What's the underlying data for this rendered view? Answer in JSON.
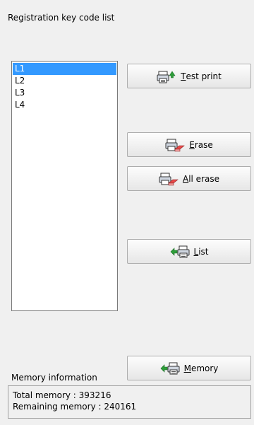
{
  "title": "Registration key code list",
  "list": {
    "items": [
      "L1",
      "L2",
      "L3",
      "L4"
    ],
    "selected_index": 0
  },
  "buttons": {
    "test_print": {
      "mnemonic": "T",
      "rest": "est print",
      "icon": "printer-arrow-icon"
    },
    "erase": {
      "mnemonic": "E",
      "rest": "rase",
      "icon": "printer-eraser-icon"
    },
    "all_erase": {
      "mnemonic": "A",
      "rest": "ll erase",
      "icon": "printer-eraser-icon"
    },
    "list": {
      "mnemonic": "L",
      "rest": "ist",
      "icon": "arrow-printer-icon"
    },
    "memory": {
      "mnemonic": "M",
      "rest": "emory",
      "icon": "arrow-printer-icon"
    }
  },
  "memory": {
    "label": "Memory information",
    "total": "Total memory : 393216",
    "remaining": "Remaining memory : 240161"
  },
  "colors": {
    "selection": "#3399ff",
    "background": "#f0f0f0",
    "arrow_green": "#2e9e3a",
    "eraser_red": "#e84a4a"
  }
}
